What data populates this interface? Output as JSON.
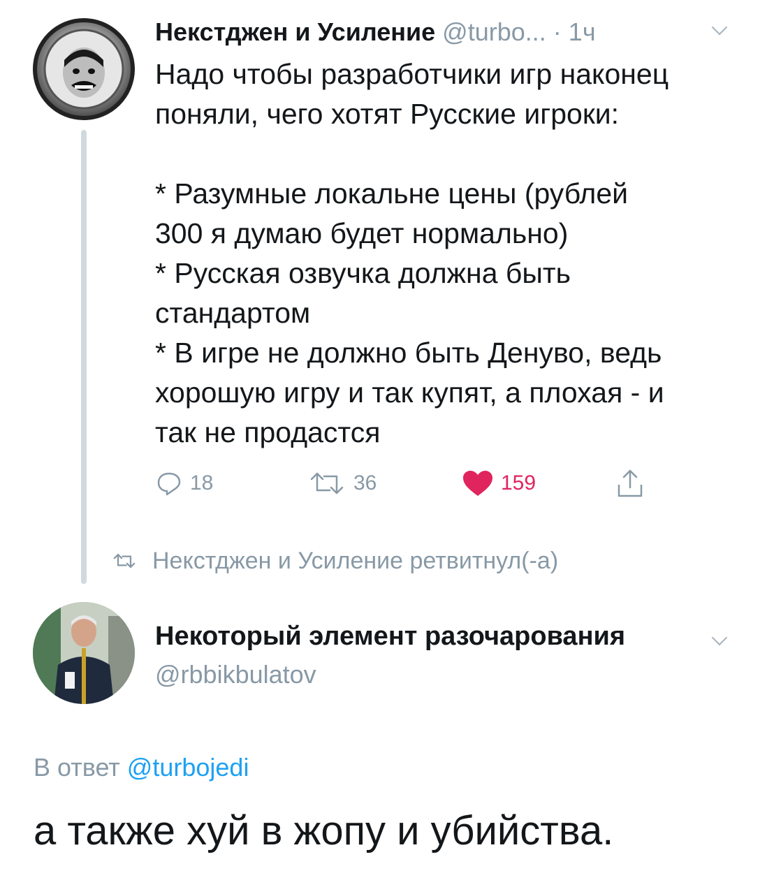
{
  "tweet1": {
    "author_name": "Некстджен и Усиление",
    "handle": "@turbo...",
    "separator": "·",
    "time": "1ч",
    "text": "Надо чтобы разработчики игр наконец\nпоняли, чего хотят Русские игроки:\n\n* Разумные локальне цены (рублей\n300 я думаю будет нормально)\n* Русская озвучка должна быть\nстандартом\n* В игре не должно быть Денуво, ведь\nхорошую игру и так купят, а плохая - и\nтак не продастся",
    "replies": "18",
    "retweets": "36",
    "likes": "159"
  },
  "retweet_notice": "Некстджен и Усиление ретвитнул(-а)",
  "tweet2": {
    "author_name": "Некоторый элемент разочарования",
    "handle": "@rbbikbulatov",
    "reply_prefix": "В ответ",
    "reply_handle": "@turbojedi",
    "text": "а также хуй в жопу и убийства."
  },
  "colors": {
    "text": "#14171a",
    "muted": "#8899a6",
    "link": "#1da1f2",
    "like": "#e0245e",
    "thread_line": "#cfd9de"
  },
  "icons": [
    "reply-icon",
    "retweet-icon",
    "heart-icon",
    "share-icon",
    "chevron-down-icon"
  ]
}
